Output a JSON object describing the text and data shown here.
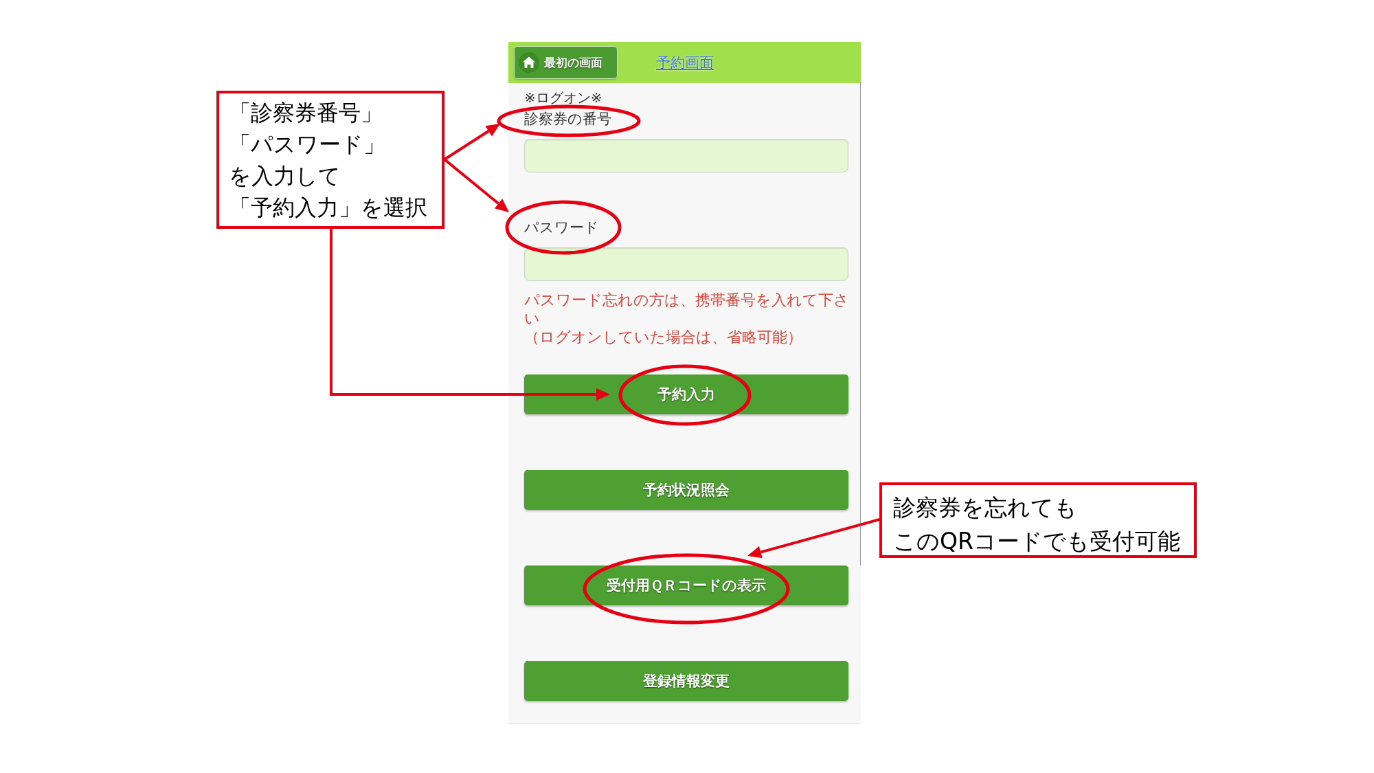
{
  "header": {
    "home_button": "最初の画面",
    "title_link": "予約画面"
  },
  "form": {
    "note": "※ログオン※",
    "fields": [
      {
        "label": "診察券の番号"
      },
      {
        "label": "パスワード"
      }
    ],
    "hint": [
      "パスワード忘れの方は、携帯番号を入れて下さい",
      "（ログオンしていた場合は、省略可能）"
    ]
  },
  "buttons": [
    "予約入力",
    "予約状況照会",
    "受付用ＱＲコードの表示",
    "登録情報変更"
  ],
  "callouts": [
    {
      "lines": [
        "「診察券番号」",
        "「パスワード」",
        "を入力して",
        "「予約入力」を選択"
      ]
    },
    {
      "lines": [
        "診察券を忘れても",
        "このQRコードでも受付可能"
      ]
    }
  ]
}
